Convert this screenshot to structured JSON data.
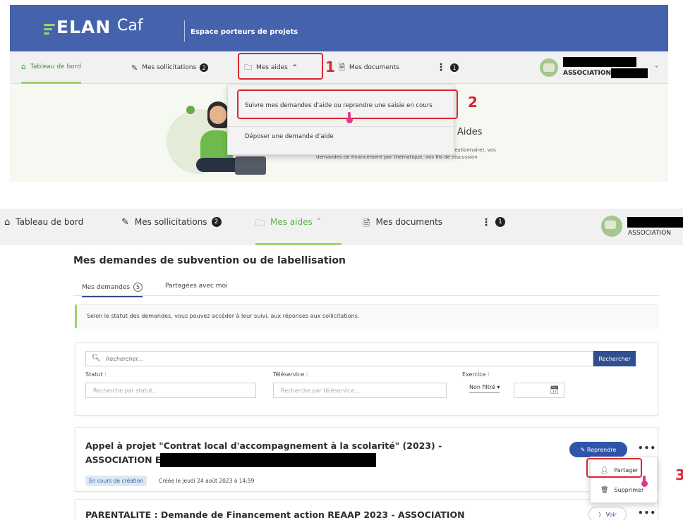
{
  "top": {
    "brand": {
      "elan": "ELAN",
      "caf": "Caf",
      "subtitle": "Espace porteurs de projets"
    },
    "nav": [
      {
        "label": "Tableau de bord",
        "icon": "home-icon"
      },
      {
        "label": "Mes sollicitations",
        "icon": "pencil-icon",
        "badge": "2"
      },
      {
        "label": "Mes aides",
        "icon": "folder-icon",
        "chevron": "^"
      },
      {
        "label": "Mes documents",
        "icon": "document-icon"
      },
      {
        "badge": "1",
        "icon": "kebab-icon"
      }
    ],
    "account": {
      "name": "ASSOCIATION",
      "chevron": "˅"
    },
    "dropdown": {
      "items": [
        "Suivre mes demandes d'aide ou reprendre une saisie en cours",
        "Déposer une demande d'aide"
      ]
    },
    "hero": {
      "title": "Aides",
      "line1": "gestionnaire), vos",
      "line2": "demandes de financement par thématique, vos fils de discussion"
    },
    "annotations": [
      "1",
      "2",
      "3"
    ]
  },
  "bottom": {
    "nav": [
      {
        "label": "Tableau de bord",
        "icon": "home-icon"
      },
      {
        "label": "Mes sollicitations",
        "icon": "pencil-icon",
        "badge": "2"
      },
      {
        "label": "Mes aides",
        "icon": "folder-icon",
        "chevron": "˅"
      },
      {
        "label": "Mes documents",
        "icon": "document-icon"
      },
      {
        "badge": "1",
        "icon": "kebab-icon"
      }
    ],
    "account": {
      "name": "ASSOCIATION"
    },
    "page_title": "Mes demandes de subvention ou de labellisation",
    "tabs": [
      {
        "label": "Mes demandes",
        "count": "5"
      },
      {
        "label": "Partagées avec moi"
      }
    ],
    "info": "Selon le statut des demandes, vous pouvez accéder à leur suivi, aux réponses aux sollicitations.",
    "search": {
      "placeholder": "Rechercher...",
      "button": "Rechercher",
      "statut_label": "Statut :",
      "statut_placeholder": "Recherche par statut...",
      "teleservice_label": "Téléservice :",
      "teleservice_placeholder": "Recherche par téléservice...",
      "exercice_label": "Exercice :",
      "exercice_value": "Non filtré ▾"
    },
    "cards": [
      {
        "title_line1": "Appel à projet \"Contrat local d'accompagnement à la scolarité\" (2023) -",
        "title_line2": "ASSOCIATION E",
        "status": "En cours de création",
        "created": "Créée le jeudi 24 août 2023 à 14:59",
        "action": "Reprendre"
      },
      {
        "title_line1": "PARENTALITE : Demande de Financement action REAAP 2023 - ASSOCIATION",
        "action": "Voir"
      }
    ],
    "card_menu": [
      "Partager",
      "Supprimer"
    ],
    "more_label": "•••"
  },
  "colors": {
    "brand_blue": "#4563ad",
    "green_accent": "#9fd36a",
    "annotation_red": "#d8272d",
    "button_blue": "#2f55a8"
  }
}
